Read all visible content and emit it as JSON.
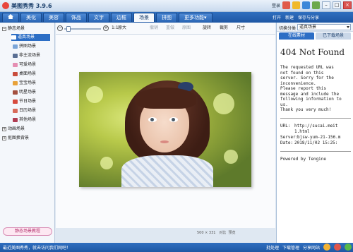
{
  "app": {
    "title": "美图秀秀 3.9.6",
    "login": "登录"
  },
  "nav": {
    "tabs": [
      "美化",
      "美容",
      "饰品",
      "文字",
      "边框",
      "场景",
      "拼图",
      "更多功能▾"
    ],
    "active_index": 5,
    "right_buttons": [
      "打开",
      "新建",
      "保存与分享"
    ]
  },
  "sidebar": {
    "categories": [
      "静态场景",
      "动画场景",
      "抠图换背景"
    ],
    "items": [
      "逼真场景",
      "拼图场景",
      "非主流场景",
      "可爱场景",
      "桌面场景",
      "宝宝场景",
      "明星场景",
      "节日场景",
      "日历场景",
      "其他场景"
    ],
    "selected_index": 0,
    "tutorial": "静态场景教程"
  },
  "toolbar": {
    "zoom": "1:1",
    "original": "原大",
    "undo": "撤销",
    "redo": "重做",
    "restore": "原图",
    "rotate": "旋转",
    "crop": "裁剪",
    "size": "尺寸"
  },
  "canvas": {
    "dimensions": "500 × 331",
    "compare": "对比",
    "preview": "预览"
  },
  "right_panel": {
    "label": "切换分类",
    "select_value": "逼真场景",
    "tabs": [
      "在线素材",
      "已下载场景"
    ],
    "active_tab": 0,
    "error": {
      "title": "404 Not Found",
      "message": [
        "The requested URL was",
        "not found on this",
        "server. Sorry for the",
        "inconvenience.",
        "Please report this",
        "message and include the",
        "following information to",
        "us.",
        "Thank you very much!"
      ],
      "url_label": "URL:",
      "url_value": "http://sucai.meit",
      "url_value2": "1.html",
      "server_label": "Server:",
      "server_value": "bjsw-yum-21-156.m",
      "date_label": "Date:",
      "date_value": "2018/11/02 15:25:",
      "footer": "Powered by Tengine"
    }
  },
  "status": {
    "text": "最近美图秀秀，就去访问我们网吧！",
    "buttons": [
      "批处理",
      "下载管理",
      "分享网站",
      "分享"
    ]
  }
}
